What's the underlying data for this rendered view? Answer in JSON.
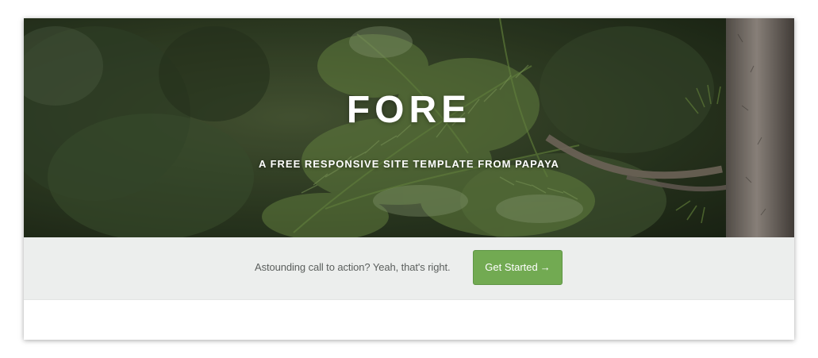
{
  "hero": {
    "title": "FORE",
    "subtitle": "A FREE RESPONSIVE SITE TEMPLATE FROM PAPAYA"
  },
  "cta": {
    "text": "Astounding call to action? Yeah, that's right.",
    "button_label": "Get Started",
    "button_arrow": "→"
  },
  "colors": {
    "accent": "#72aa52",
    "band_background": "#eceeed",
    "band_text": "#5b5f5d"
  }
}
